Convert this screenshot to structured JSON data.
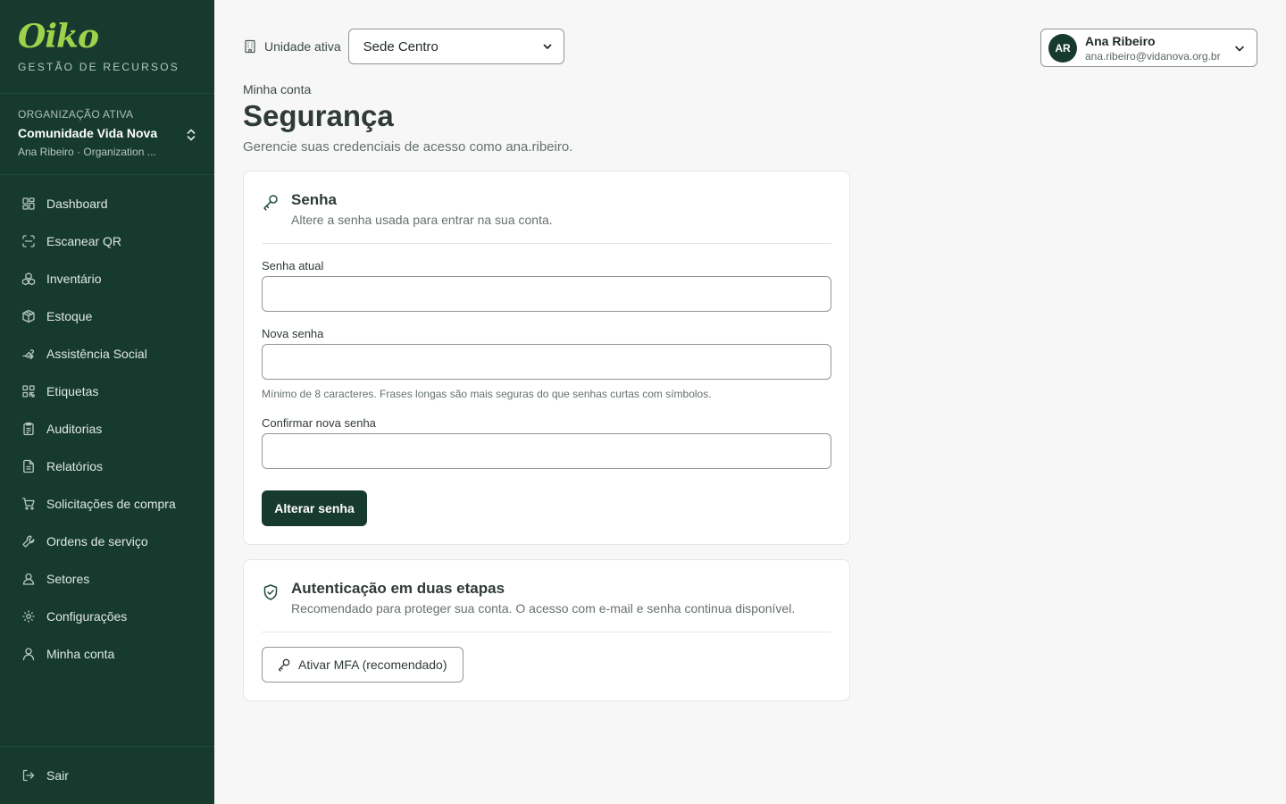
{
  "sidebar": {
    "logo": "Oiko",
    "tagline": "GESTÃO DE RECURSOS",
    "org_label": "ORGANIZAÇÃO ATIVA",
    "org_name": "Comunidade Vida Nova",
    "org_sub": "Ana Ribeiro · Organization ...",
    "items": [
      {
        "label": "Dashboard",
        "icon": "dashboard-icon"
      },
      {
        "label": "Escanear QR",
        "icon": "scan-icon"
      },
      {
        "label": "Inventário",
        "icon": "boxes-icon"
      },
      {
        "label": "Estoque",
        "icon": "package-icon"
      },
      {
        "label": "Assistência Social",
        "icon": "hand-heart-icon"
      },
      {
        "label": "Etiquetas",
        "icon": "qr-code-icon"
      },
      {
        "label": "Auditorias",
        "icon": "clipboard-icon"
      },
      {
        "label": "Relatórios",
        "icon": "file-text-icon"
      },
      {
        "label": "Solicitações de compra",
        "icon": "cart-icon"
      },
      {
        "label": "Ordens de serviço",
        "icon": "wrench-icon"
      },
      {
        "label": "Setores",
        "icon": "users-icon"
      },
      {
        "label": "Configurações",
        "icon": "gear-icon"
      },
      {
        "label": "Minha conta",
        "icon": "user-icon"
      }
    ],
    "logout": "Sair"
  },
  "topbar": {
    "unit_label": "Unidade ativa",
    "unit_value": "Sede Centro",
    "user_initials": "AR",
    "user_name": "Ana Ribeiro",
    "user_email": "ana.ribeiro@vidanova.org.br"
  },
  "page": {
    "breadcrumb": "Minha conta",
    "title": "Segurança",
    "subtitle": "Gerencie suas credenciais de acesso como ana.ribeiro."
  },
  "password_card": {
    "title": "Senha",
    "description": "Altere a senha usada para entrar na sua conta.",
    "current_label": "Senha atual",
    "current_value": "",
    "new_label": "Nova senha",
    "new_value": "",
    "hint": "Mínimo de 8 caracteres. Frases longas são mais seguras do que senhas curtas com símbolos.",
    "confirm_label": "Confirmar nova senha",
    "confirm_value": "",
    "submit": "Alterar senha"
  },
  "mfa_card": {
    "title": "Autenticação em duas etapas",
    "description": "Recomendado para proteger sua conta. O acesso com e-mail e senha continua disponível.",
    "button": "Ativar MFA (recomendado)"
  },
  "colors": {
    "sidebar_bg": "#173a2f",
    "brand_accent": "#9fd14a",
    "primary": "#173a2f"
  }
}
